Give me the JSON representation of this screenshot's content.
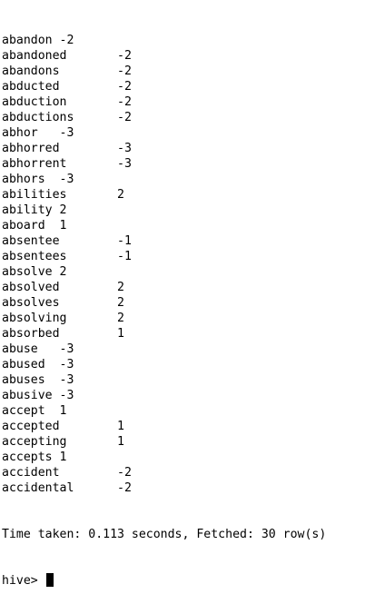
{
  "terminal": {
    "rows": [
      {
        "word": "abandon",
        "sep": " ",
        "score": "-2"
      },
      {
        "word": "abandoned",
        "sep": "\t",
        "score": "-2"
      },
      {
        "word": "abandons",
        "sep": "\t",
        "score": "-2"
      },
      {
        "word": "abducted",
        "sep": "\t",
        "score": "-2"
      },
      {
        "word": "abduction",
        "sep": "\t",
        "score": "-2"
      },
      {
        "word": "abductions",
        "sep": "\t",
        "score": "-2"
      },
      {
        "word": "abhor",
        "sep": "   ",
        "score": "-3"
      },
      {
        "word": "abhorred",
        "sep": "\t",
        "score": "-3"
      },
      {
        "word": "abhorrent",
        "sep": "\t",
        "score": "-3"
      },
      {
        "word": "abhors",
        "sep": "  ",
        "score": "-3"
      },
      {
        "word": "abilities",
        "sep": "\t",
        "score": "2"
      },
      {
        "word": "ability",
        "sep": " ",
        "score": "2"
      },
      {
        "word": "aboard",
        "sep": "  ",
        "score": "1"
      },
      {
        "word": "absentee",
        "sep": "\t",
        "score": "-1"
      },
      {
        "word": "absentees",
        "sep": "\t",
        "score": "-1"
      },
      {
        "word": "absolve",
        "sep": " ",
        "score": "2"
      },
      {
        "word": "absolved",
        "sep": "\t",
        "score": "2"
      },
      {
        "word": "absolves",
        "sep": "\t",
        "score": "2"
      },
      {
        "word": "absolving",
        "sep": "\t",
        "score": "2"
      },
      {
        "word": "absorbed",
        "sep": "\t",
        "score": "1"
      },
      {
        "word": "abuse",
        "sep": "   ",
        "score": "-3"
      },
      {
        "word": "abused",
        "sep": "  ",
        "score": "-3"
      },
      {
        "word": "abuses",
        "sep": "  ",
        "score": "-3"
      },
      {
        "word": "abusive",
        "sep": " ",
        "score": "-3"
      },
      {
        "word": "accept",
        "sep": "  ",
        "score": "1"
      },
      {
        "word": "accepted",
        "sep": "\t",
        "score": "1"
      },
      {
        "word": "accepting",
        "sep": "\t",
        "score": "1"
      },
      {
        "word": "accepts",
        "sep": " ",
        "score": "1"
      },
      {
        "word": "accident",
        "sep": "\t",
        "score": "-2"
      },
      {
        "word": "accidental",
        "sep": "\t",
        "score": "-2"
      }
    ],
    "status_line": "Time taken: 0.113 seconds, Fetched: 30 row(s)",
    "prompt": "hive> "
  }
}
